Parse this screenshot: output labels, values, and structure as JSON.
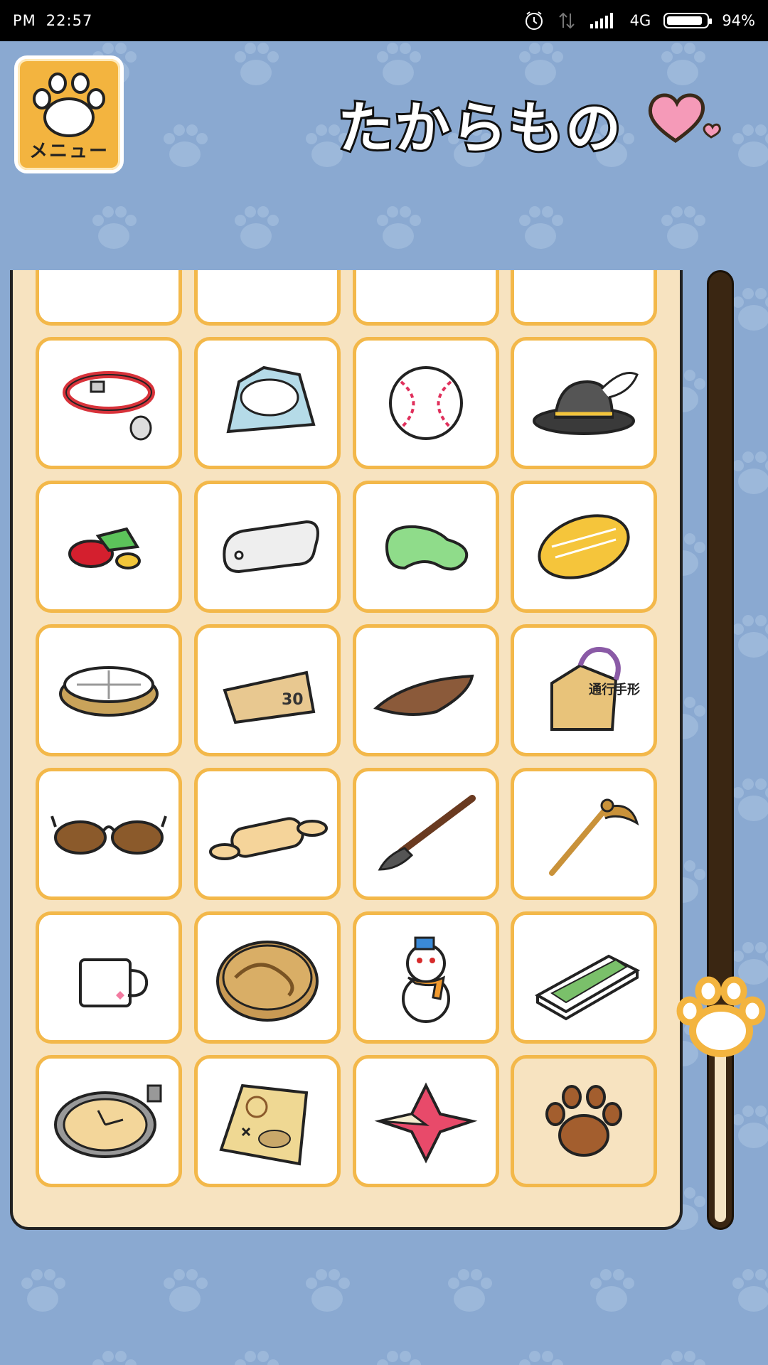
{
  "status_bar": {
    "ampm": "PM",
    "time": "22:57",
    "network": "4G",
    "battery": "94%",
    "battery_level": 0.94
  },
  "header": {
    "menu_label": "メニュー",
    "title": "たからもの"
  },
  "colors": {
    "background": "#8aa9d1",
    "panel": "#f7e3c0",
    "cell_border": "#f3b84a",
    "menu_button": "#f3b43f",
    "scroll_track": "#3a2612"
  },
  "scroll": {
    "position": 0.78
  },
  "items": [
    {
      "icon": "pencil-icon"
    },
    {
      "icon": "bone-icon"
    },
    {
      "icon": "acorn-icon"
    },
    {
      "icon": "ribbon-icon"
    },
    {
      "icon": "collar-icon"
    },
    {
      "icon": "bandana-icon"
    },
    {
      "icon": "baseball-icon"
    },
    {
      "icon": "feather-hat-icon"
    },
    {
      "icon": "gems-icon"
    },
    {
      "icon": "dog-tag-icon"
    },
    {
      "icon": "green-magatama-icon"
    },
    {
      "icon": "gold-koban-icon"
    },
    {
      "icon": "compass-icon"
    },
    {
      "icon": "ticket-icon",
      "text": "30"
    },
    {
      "icon": "katsuobushi-icon"
    },
    {
      "icon": "pass-charm-icon",
      "text": "通行手形"
    },
    {
      "icon": "sunglasses-icon"
    },
    {
      "icon": "rolling-pin-icon"
    },
    {
      "icon": "brush-icon"
    },
    {
      "icon": "caduceus-icon"
    },
    {
      "icon": "mug-icon"
    },
    {
      "icon": "dragon-coin-icon"
    },
    {
      "icon": "snowman-icon"
    },
    {
      "icon": "sketchbook-icon"
    },
    {
      "icon": "pocket-watch-icon"
    },
    {
      "icon": "treasure-map-icon"
    },
    {
      "icon": "shuriken-icon"
    },
    {
      "icon": "empty-paw-icon"
    }
  ]
}
